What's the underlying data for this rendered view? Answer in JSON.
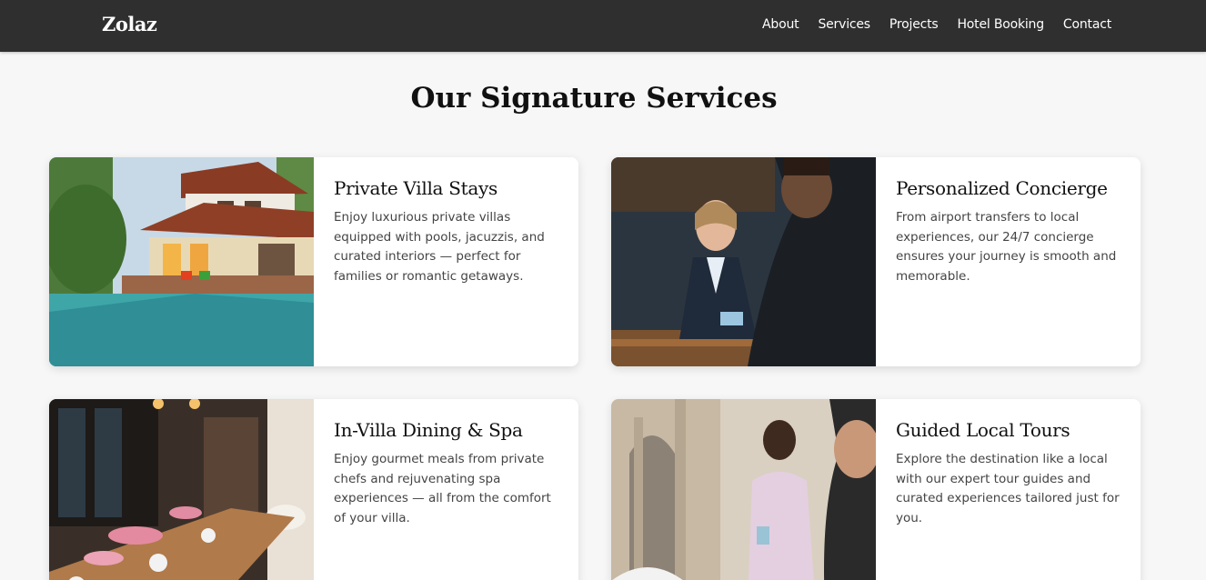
{
  "brand": {
    "name": "Zolaz"
  },
  "nav": {
    "links": [
      {
        "label": "About"
      },
      {
        "label": "Services"
      },
      {
        "label": "Projects"
      },
      {
        "label": "Hotel Booking"
      },
      {
        "label": "Contact"
      }
    ]
  },
  "services": {
    "title": "Our Signature Services",
    "cards": [
      {
        "title": "Private Villa Stays",
        "text": "Enjoy luxurious private villas equipped with pools, jacuzzis, and curated interiors — perfect for families or romantic getaways.",
        "image_icon": "villa-pool-photo"
      },
      {
        "title": "Personalized Concierge",
        "text": "From airport transfers to local experiences, our 24/7 concierge ensures your journey is smooth and memorable.",
        "image_icon": "concierge-desk-photo"
      },
      {
        "title": "In-Villa Dining & Spa",
        "text": "Enjoy gourmet meals from private chefs and rejuvenating spa experiences — all from the comfort of your villa.",
        "image_icon": "dining-table-photo"
      },
      {
        "title": "Guided Local Tours",
        "text": "Explore the destination like a local with our expert tour guides and curated experiences tailored just for you.",
        "image_icon": "tour-guide-photo"
      }
    ]
  },
  "colors": {
    "navbar_bg": "#2f2f2f",
    "page_bg": "#f7f7f7",
    "card_bg": "#ffffff",
    "heading": "#111111",
    "body_text": "#444444"
  }
}
